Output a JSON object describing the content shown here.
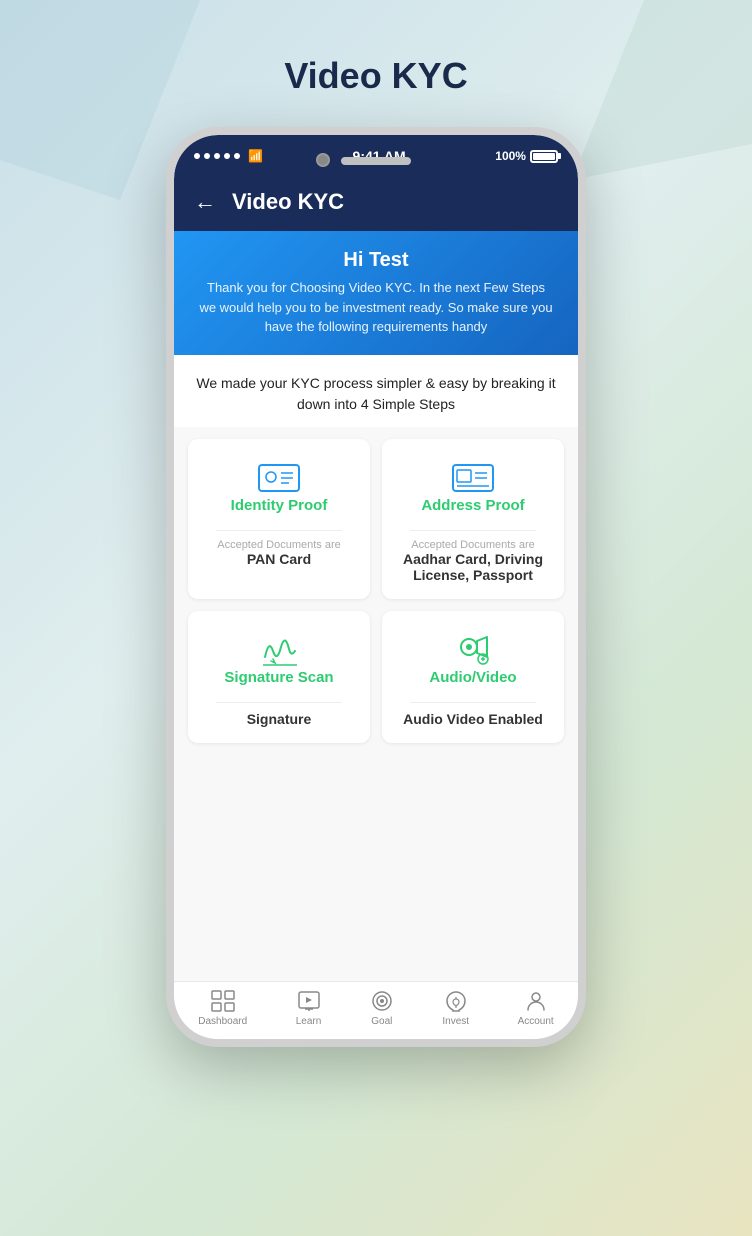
{
  "page": {
    "title": "Video KYC"
  },
  "background": {
    "color_start": "#c8dfe8",
    "color_end": "#e8e4c0"
  },
  "statusBar": {
    "time": "9:41 AM",
    "battery": "100%"
  },
  "header": {
    "back_label": "←",
    "title": "Video KYC"
  },
  "banner": {
    "greeting": "Hi Test",
    "text": "Thank you for Choosing Video KYC. In the next Few Steps we would help you to be investment ready. So make sure you have the following requirements handy"
  },
  "subtitle": "We made your KYC process simpler & easy by breaking it down into 4 Simple Steps",
  "steps": [
    {
      "id": "identity",
      "label": "Identity Proof",
      "accepted_label": "Accepted Documents are",
      "documents": "PAN Card",
      "icon": "id-card"
    },
    {
      "id": "address",
      "label": "Address Proof",
      "accepted_label": "Accepted Documents are",
      "documents": "Aadhar Card, Driving License, Passport",
      "icon": "address-card"
    },
    {
      "id": "signature",
      "label": "Signature Scan",
      "accepted_label": "",
      "documents": "Signature",
      "icon": "signature"
    },
    {
      "id": "video",
      "label": "Audio/Video",
      "accepted_label": "",
      "documents": "Audio Video Enabled",
      "icon": "video"
    }
  ],
  "bottomNav": [
    {
      "id": "dashboard",
      "label": "Dashboard",
      "icon": "grid"
    },
    {
      "id": "learn",
      "label": "Learn",
      "icon": "monitor"
    },
    {
      "id": "goal",
      "label": "Goal",
      "icon": "target"
    },
    {
      "id": "invest",
      "label": "Invest",
      "icon": "piggy"
    },
    {
      "id": "account",
      "label": "Account",
      "icon": "person"
    }
  ]
}
